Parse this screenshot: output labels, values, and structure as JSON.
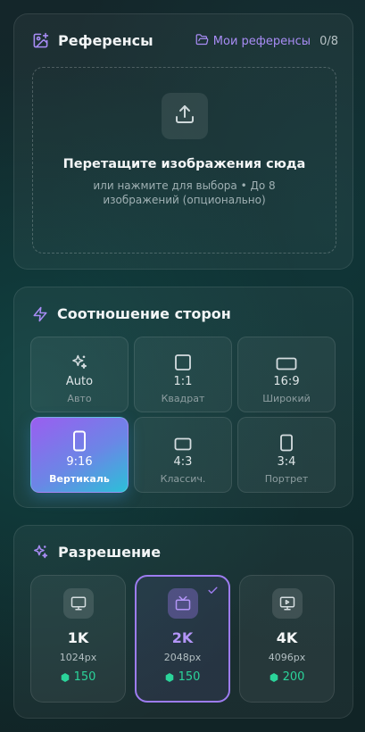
{
  "references": {
    "title": "Референсы",
    "my_refs_label": "Мои референсы",
    "count": "0/8",
    "drop_title": "Перетащите изображения сюда",
    "drop_subtitle": "или нажмите для выбора • До 8 изображений (опционально)"
  },
  "aspect": {
    "title": "Соотношение сторон",
    "selected": "9:16",
    "options": [
      {
        "value": "Auto",
        "caption": "Авто",
        "icon": "sparkle-icon"
      },
      {
        "value": "1:1",
        "caption": "Квадрат",
        "icon": "square-icon"
      },
      {
        "value": "16:9",
        "caption": "Широкий",
        "icon": "landscape-icon"
      },
      {
        "value": "9:16",
        "caption": "Вертикаль",
        "icon": "phone-portrait-icon"
      },
      {
        "value": "4:3",
        "caption": "Классич.",
        "icon": "classic-rect-icon"
      },
      {
        "value": "3:4",
        "caption": "Портрет",
        "icon": "portrait-icon"
      }
    ]
  },
  "resolution": {
    "title": "Разрешение",
    "selected": "2K",
    "options": [
      {
        "label": "1K",
        "px": "1024px",
        "cost": "150",
        "icon": "monitor-icon"
      },
      {
        "label": "2K",
        "px": "2048px",
        "cost": "150",
        "icon": "tv-icon"
      },
      {
        "label": "4K",
        "px": "4096px",
        "cost": "200",
        "icon": "play-screen-icon"
      }
    ]
  },
  "colors": {
    "accent_purple": "#a88cf5",
    "cost_green": "#2bd49a",
    "selected_gradient_start": "#9a5ef0",
    "selected_gradient_end": "#2bc0d8"
  }
}
